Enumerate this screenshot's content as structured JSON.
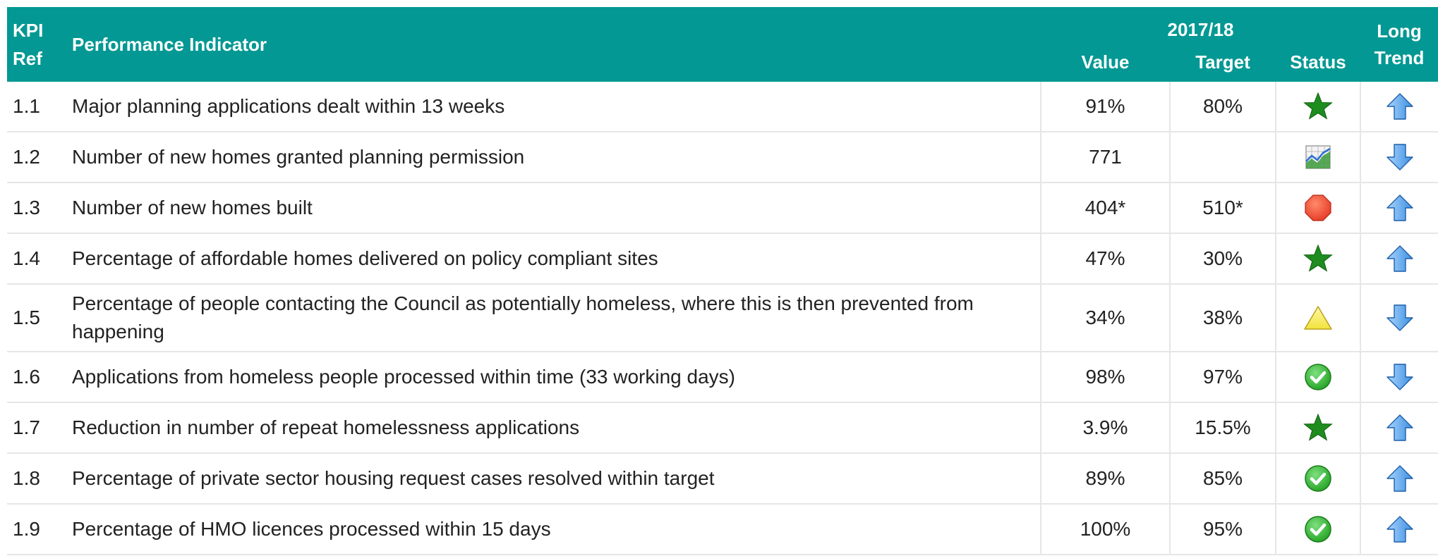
{
  "header": {
    "kpi_ref": "KPI Ref",
    "indicator": "Performance Indicator",
    "year": "2017/18",
    "value": "Value",
    "target": "Target",
    "status": "Status",
    "trend": "Long Trend"
  },
  "rows": [
    {
      "ref": "1.1",
      "indicator": "Major planning applications dealt within 13 weeks",
      "value": "91%",
      "target": "80%",
      "status": "green-star-icon",
      "trend": "up-arrow-icon"
    },
    {
      "ref": "1.2",
      "indicator": "Number of new homes granted planning permission",
      "value": "771",
      "target": "",
      "status": "data-only-chart-icon",
      "trend": "down-arrow-icon"
    },
    {
      "ref": "1.3",
      "indicator": "Number of new homes built",
      "value": "404*",
      "target": "510*",
      "status": "red-octagon-icon",
      "trend": "up-arrow-icon"
    },
    {
      "ref": "1.4",
      "indicator": "Percentage of affordable homes delivered on policy compliant sites",
      "value": "47%",
      "target": "30%",
      "status": "green-star-icon",
      "trend": "up-arrow-icon"
    },
    {
      "ref": "1.5",
      "indicator": "Percentage of people contacting the Council as potentially homeless, where this is then prevented from happening",
      "value": "34%",
      "target": "38%",
      "status": "amber-triangle-icon",
      "trend": "down-arrow-icon"
    },
    {
      "ref": "1.6",
      "indicator": "Applications from homeless people processed within time (33 working days)",
      "value": "98%",
      "target": "97%",
      "status": "green-check-icon",
      "trend": "down-arrow-icon"
    },
    {
      "ref": "1.7",
      "indicator": "Reduction in number of repeat homelessness applications",
      "value": "3.9%",
      "target": "15.5%",
      "status": "green-star-icon",
      "trend": "up-arrow-icon"
    },
    {
      "ref": "1.8",
      "indicator": "Percentage of private sector housing request cases resolved within target",
      "value": "89%",
      "target": "85%",
      "status": "green-check-icon",
      "trend": "up-arrow-icon"
    },
    {
      "ref": "1.9",
      "indicator": "Percentage of HMO licences processed within 15 days",
      "value": "100%",
      "target": "95%",
      "status": "green-check-icon",
      "trend": "up-arrow-icon"
    }
  ],
  "colors": {
    "header_bg": "#039893",
    "header_text": "#ffffff",
    "star": "#1e8c1e",
    "check": "#2aa62a",
    "octagon": "#e8402a",
    "triangle": "#f2e23c",
    "arrow": "#3d8fe0"
  }
}
